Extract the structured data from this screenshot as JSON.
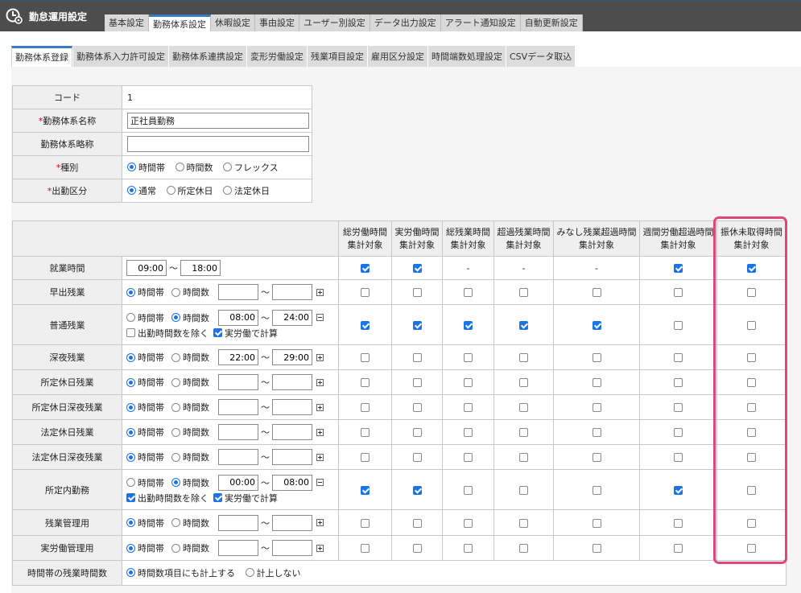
{
  "app": {
    "title": "勤怠運用設定",
    "icon": "clock-gear-icon"
  },
  "top_tabs": [
    "基本設定",
    "勤務体系設定",
    "休暇設定",
    "事由設定",
    "ユーザー別設定",
    "データ出力設定",
    "アラート通知設定",
    "自動更新設定"
  ],
  "sub_tabs": [
    "勤務体系登録",
    "勤務体系入力許可設定",
    "勤務体系連携設定",
    "変形労働設定",
    "残業項目設定",
    "雇用区分設定",
    "時間端数処理設定",
    "CSVデータ取込"
  ],
  "basic": {
    "code_label": "コード",
    "code_value": "1",
    "required_mark": "*",
    "name_label": "勤務体系名称",
    "name_value": "正社員勤務",
    "short_label": "勤務体系略称",
    "short_value": "",
    "type_label": "種別",
    "type_options": [
      "時間帯",
      "時間数",
      "フレックス"
    ],
    "attend_label": "出勤区分",
    "attend_options": [
      "通常",
      "所定休日",
      "法定休日"
    ]
  },
  "columns": [
    {
      "l1": "総労働時間",
      "l2": "集計対象"
    },
    {
      "l1": "実労働時間",
      "l2": "集計対象"
    },
    {
      "l1": "総残業時間",
      "l2": "集計対象"
    },
    {
      "l1": "超過残業時間",
      "l2": "集計対象"
    },
    {
      "l1": "みなし残業超過時間",
      "l2": "集計対象"
    },
    {
      "l1": "週間労働超過時間",
      "l2": "集計対象"
    },
    {
      "l1": "振休未取得時間",
      "l2": "集計対象"
    }
  ],
  "options": {
    "band": "時間帯",
    "count": "時間数",
    "tilde": "〜",
    "exclude_label": "出勤時間数を除く",
    "actual_label": "実労働で計算"
  },
  "work_hours": {
    "label": "就業時間",
    "start": "09:00",
    "end": "18:00"
  },
  "rows": [
    {
      "label": "早出残業",
      "start": "",
      "end": ""
    },
    {
      "label": "普通残業",
      "start": "08:00",
      "end": "24:00"
    },
    {
      "label": "深夜残業",
      "start": "22:00",
      "end": "29:00"
    },
    {
      "label": "所定休日残業",
      "start": "",
      "end": ""
    },
    {
      "label": "所定休日深夜残業",
      "start": "",
      "end": ""
    },
    {
      "label": "法定休日残業",
      "start": "",
      "end": ""
    },
    {
      "label": "法定休日深夜残業",
      "start": "",
      "end": ""
    },
    {
      "label": "所定内勤務",
      "start": "00:00",
      "end": "08:00"
    },
    {
      "label": "残業管理用",
      "start": "",
      "end": ""
    },
    {
      "label": "実労働管理用",
      "start": "",
      "end": ""
    }
  ],
  "na_mark": "-",
  "overtime_count": {
    "label": "時間帯の残業時間数",
    "options": [
      "時間数項目にも計上する",
      "計上しない"
    ]
  },
  "highlight_color": "#e0457b",
  "accent_color": "#1a73e8"
}
